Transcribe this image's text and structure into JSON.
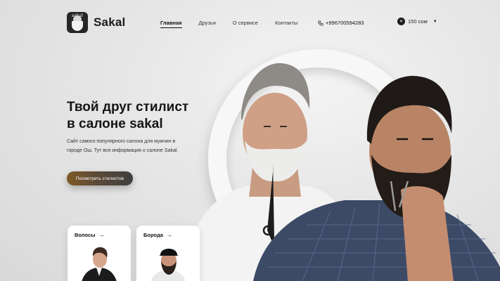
{
  "brand": {
    "logo_script": "sakal",
    "name": "Sakal"
  },
  "nav": {
    "items": [
      {
        "label": "Главная",
        "active": true
      },
      {
        "label": "Друзья",
        "active": false
      },
      {
        "label": "О сервисе",
        "active": false
      },
      {
        "label": "Контакты",
        "active": false
      }
    ],
    "phone": "+996700594283"
  },
  "currency": {
    "value": "150 сом",
    "icon": "currency-icon"
  },
  "hero": {
    "title_line1": "Твой друг стилист",
    "title_line2": "в салоне sakal",
    "description": "Сайт самого популярного салона для мужчин в городе Ош. Тут вся информация о салоне Sakal.",
    "cta_label": "Посмотреть стилистов"
  },
  "cards": [
    {
      "label": "Волосы",
      "arrow": "→"
    },
    {
      "label": "Борода",
      "arrow": "→"
    }
  ],
  "colors": {
    "cta_gold": "#7d5a26",
    "cta_dark": "#3e3e3e",
    "background": "#e6e6e6"
  }
}
